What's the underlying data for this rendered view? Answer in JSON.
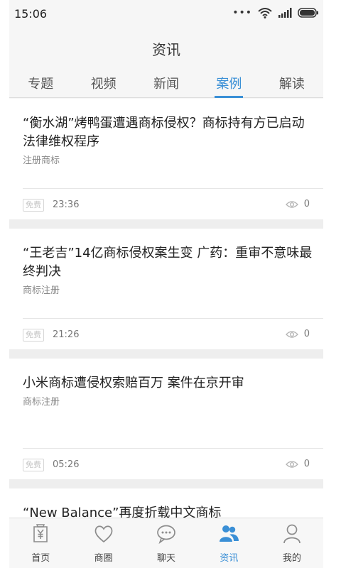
{
  "status_bar": {
    "time": "15:06"
  },
  "header": {
    "title": "资讯"
  },
  "tabs": [
    {
      "label": "专题",
      "active": false
    },
    {
      "label": "视频",
      "active": false
    },
    {
      "label": "新闻",
      "active": false
    },
    {
      "label": "案例",
      "active": true
    },
    {
      "label": "解读",
      "active": false
    }
  ],
  "articles": [
    {
      "title": "“衡水湖”烤鸭蛋遭遇商标侵权？商标持有方已启动法律维权程序",
      "category": "注册商标",
      "badge": "免费",
      "time": "23:36",
      "views": "0"
    },
    {
      "title": "“王老吉”14亿商标侵权案生变 广药：重审不意味最终判决",
      "category": "商标注册",
      "badge": "免费",
      "time": "21:26",
      "views": "0"
    },
    {
      "title": "小米商标遭侵权索赔百万 案件在京开审",
      "category": "商标注册",
      "badge": "免费",
      "time": "05:26",
      "views": "0"
    },
    {
      "title": "“New Balance”再度折载中文商标"
    }
  ],
  "bottom_nav": [
    {
      "label": "首页",
      "icon": "home-yen-icon",
      "active": false
    },
    {
      "label": "商圈",
      "icon": "heart-icon",
      "active": false
    },
    {
      "label": "聊天",
      "icon": "chat-bubble-icon",
      "active": false
    },
    {
      "label": "资讯",
      "icon": "users-icon",
      "active": true
    },
    {
      "label": "我的",
      "icon": "person-icon",
      "active": false
    }
  ],
  "colors": {
    "accent": "#3a8fd6",
    "text": "#222222",
    "muted": "#8a8a8a",
    "background": "#f6f6f6"
  }
}
